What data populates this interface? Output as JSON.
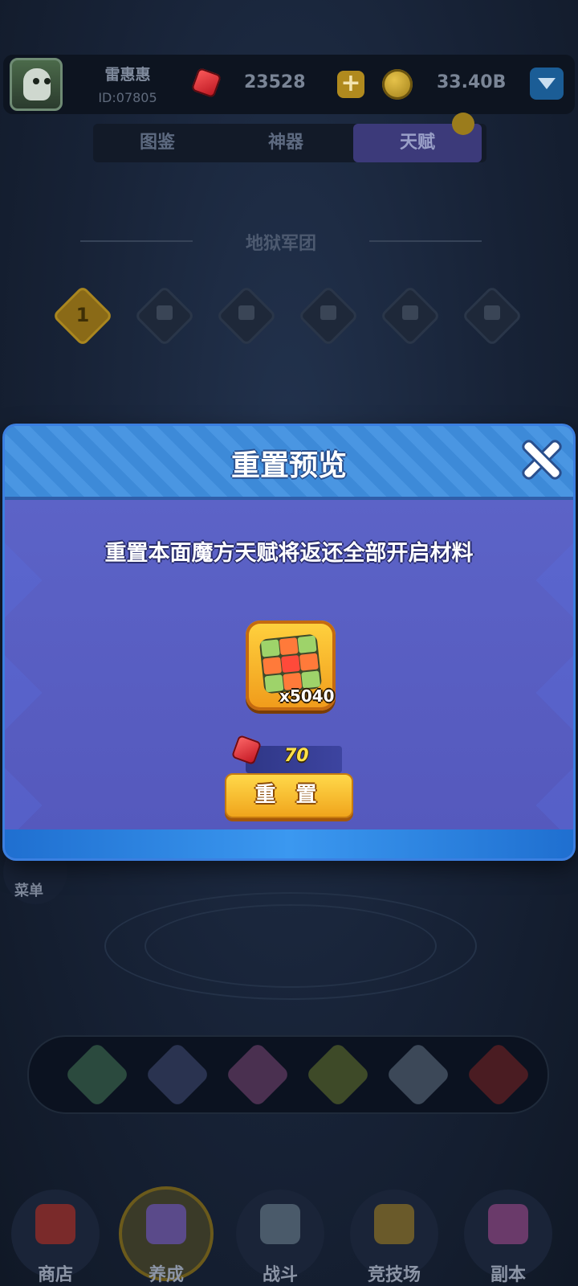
{
  "profile": {
    "name": "雷惠惠",
    "id": "ID:07805"
  },
  "resources": {
    "gems": "23528",
    "gold": "33.40B"
  },
  "tabs": [
    {
      "label": "图鉴"
    },
    {
      "label": "神器"
    },
    {
      "label": "天赋",
      "active": true
    }
  ],
  "section": {
    "title": "地狱军团"
  },
  "levels": [
    {
      "label": "1",
      "unlocked": true
    },
    {
      "label": "",
      "unlocked": false
    },
    {
      "label": "",
      "unlocked": false
    },
    {
      "label": "",
      "unlocked": false
    },
    {
      "label": "",
      "unlocked": false
    },
    {
      "label": "",
      "unlocked": false
    }
  ],
  "menu": {
    "label": "菜单"
  },
  "modal": {
    "title": "重置预览",
    "description": "重置本面魔方天赋将返还全部开启材料",
    "item": {
      "icon": "cube-icon",
      "quantity": "x5040"
    },
    "cost": {
      "icon": "gem-icon",
      "value": "70"
    },
    "reset_label": "重 置"
  },
  "bottom_nav": [
    {
      "label": "商店",
      "icon": "gift-icon"
    },
    {
      "label": "养成",
      "icon": "card-icon",
      "active": true
    },
    {
      "label": "战斗",
      "icon": "swords-icon"
    },
    {
      "label": "竞技场",
      "icon": "arena-icon"
    },
    {
      "label": "副本",
      "icon": "dungeon-icon"
    }
  ],
  "colors": {
    "accent_gold": "#f0a51c",
    "modal_blue": "#5a62c6",
    "gem_red": "#c0121e"
  }
}
